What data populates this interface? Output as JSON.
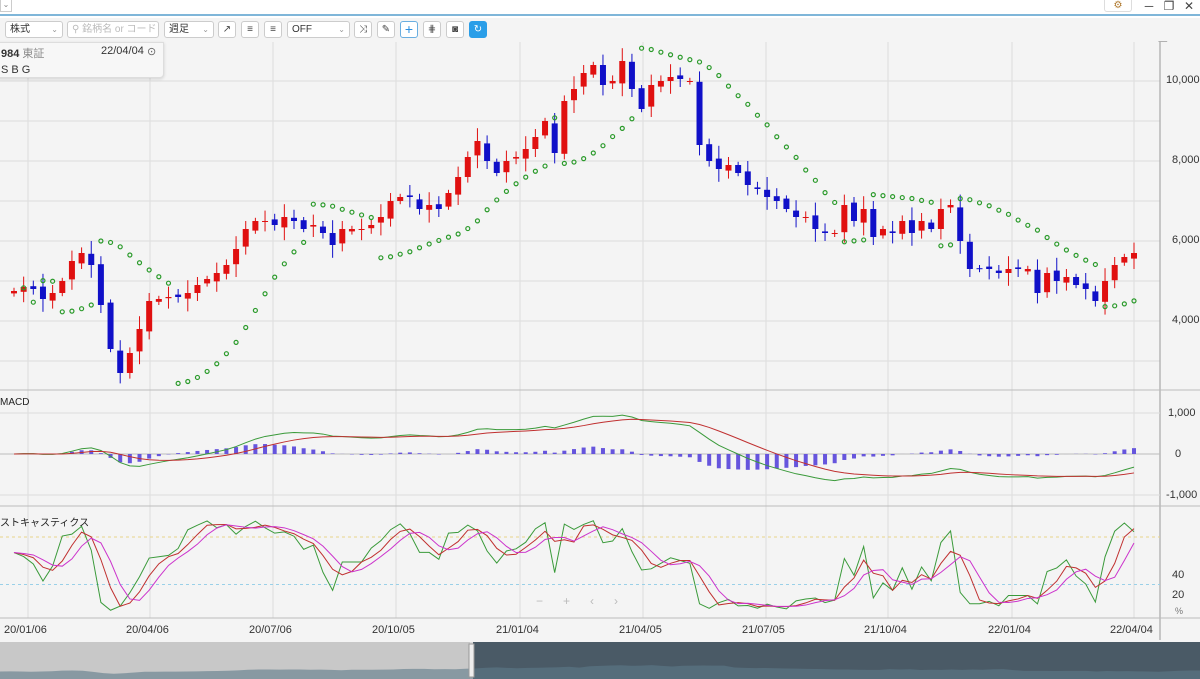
{
  "window": {
    "controls": [
      "─",
      "❐",
      "✕"
    ]
  },
  "toolbar": {
    "market": "株式",
    "search_placeholder": "銘柄名 or コード",
    "period": "週足",
    "overlay": "OFF"
  },
  "info": {
    "code": "984",
    "exchange": "東証",
    "date": "22/04/04",
    "name": "S B G"
  },
  "panels": {
    "macd": "MACD",
    "stoch": "ストキャスティクス"
  },
  "price_axis": [
    "10,000",
    "8,000",
    "6,000",
    "4,000"
  ],
  "macd_axis": [
    "1,000",
    "0",
    "-1,000"
  ],
  "stoch_axis": [
    "40",
    "20",
    "%"
  ],
  "dates": [
    "20/01/06",
    "20/04/06",
    "20/07/06",
    "20/10/05",
    "21/01/04",
    "21/04/05",
    "21/07/05",
    "21/10/04",
    "22/01/04",
    "22/04/04"
  ],
  "colors": {
    "up": "#e01010",
    "down": "#1010c8",
    "sar": "#2a9a2a",
    "macd": "#3a9a3a",
    "signal": "#c03030",
    "hist": "#6655dd",
    "k": "#3a9a3a",
    "d": "#c03030",
    "sd": "#cc33cc",
    "accent": "#2a9ee8"
  },
  "chart_data": {
    "type": "candlestick",
    "interval": "weekly",
    "ylim": [
      2500,
      10800
    ],
    "closes": [
      4750,
      4850,
      4800,
      4550,
      4700,
      5000,
      5500,
      5700,
      5400,
      4400,
      3300,
      2700,
      3200,
      3800,
      4500,
      4550,
      4600,
      4600,
      4700,
      4900,
      5050,
      5200,
      5400,
      5800,
      6300,
      6500,
      6500,
      6400,
      6600,
      6500,
      6300,
      6400,
      6200,
      5900,
      6300,
      6300,
      6300,
      6400,
      6600,
      7000,
      7100,
      7100,
      6800,
      6900,
      6800,
      7200,
      7600,
      8100,
      8500,
      8000,
      7700,
      8000,
      8100,
      8300,
      8600,
      9000,
      8200,
      9500,
      9800,
      10200,
      10400,
      9900,
      10000,
      10500,
      9800,
      9300,
      9900,
      10000,
      10100,
      10050,
      10000,
      8400,
      8000,
      7800,
      7900,
      7700,
      7400,
      7300,
      7100,
      7000,
      6800,
      6600,
      6600,
      6300,
      6200,
      6200,
      6900,
      6500,
      6800,
      6100,
      6300,
      6200,
      6500,
      6200,
      6500,
      6300,
      6800,
      6900,
      6000,
      5300,
      5300,
      5300,
      5200,
      5300,
      5300,
      5300,
      4700,
      5200,
      5000,
      5100,
      4900,
      4800,
      4500,
      5000,
      5400,
      5600,
      5700
    ]
  }
}
